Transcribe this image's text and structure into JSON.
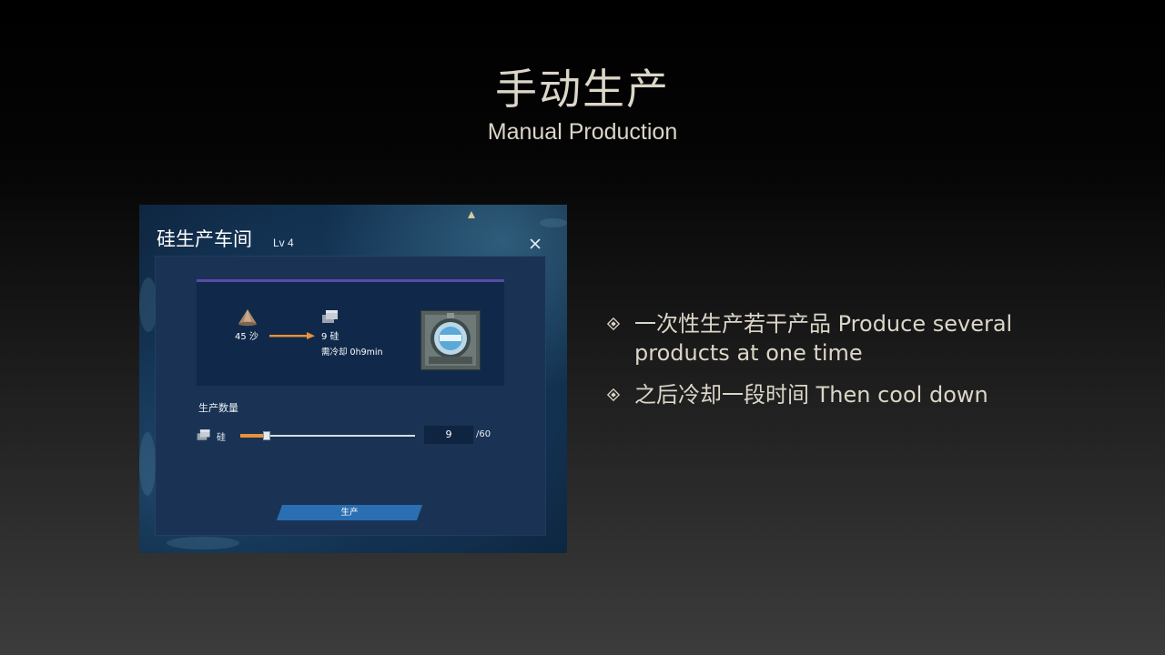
{
  "slide": {
    "title": "手动生产",
    "subtitle": "Manual Production"
  },
  "window": {
    "title": "硅生产车间",
    "level": "Lv 4",
    "close_icon": "close-icon",
    "recipe": {
      "input_label": "45 沙",
      "input_icon": "sand-icon",
      "output_label": "9 硅",
      "output_icon": "silicon-icon",
      "cooldown_label": "需冷却 0h9min",
      "arrow_color": "#e8923a",
      "building_icon": "workshop-building-icon"
    },
    "quantity": {
      "label": "生产数量",
      "item_label": "硅",
      "value": "9",
      "max_label": "/60",
      "current": 9,
      "max": 60,
      "slider_color": "#e8923a"
    },
    "produce_button": "生产",
    "produce_button_color": "#2b6fb3"
  },
  "bullets": [
    {
      "text": "一次性生产若干产品 Produce several products at one time",
      "icon": "diamond-bullet-icon"
    },
    {
      "text": "之后冷却一段时间 Then cool down",
      "icon": "diamond-bullet-icon"
    }
  ]
}
